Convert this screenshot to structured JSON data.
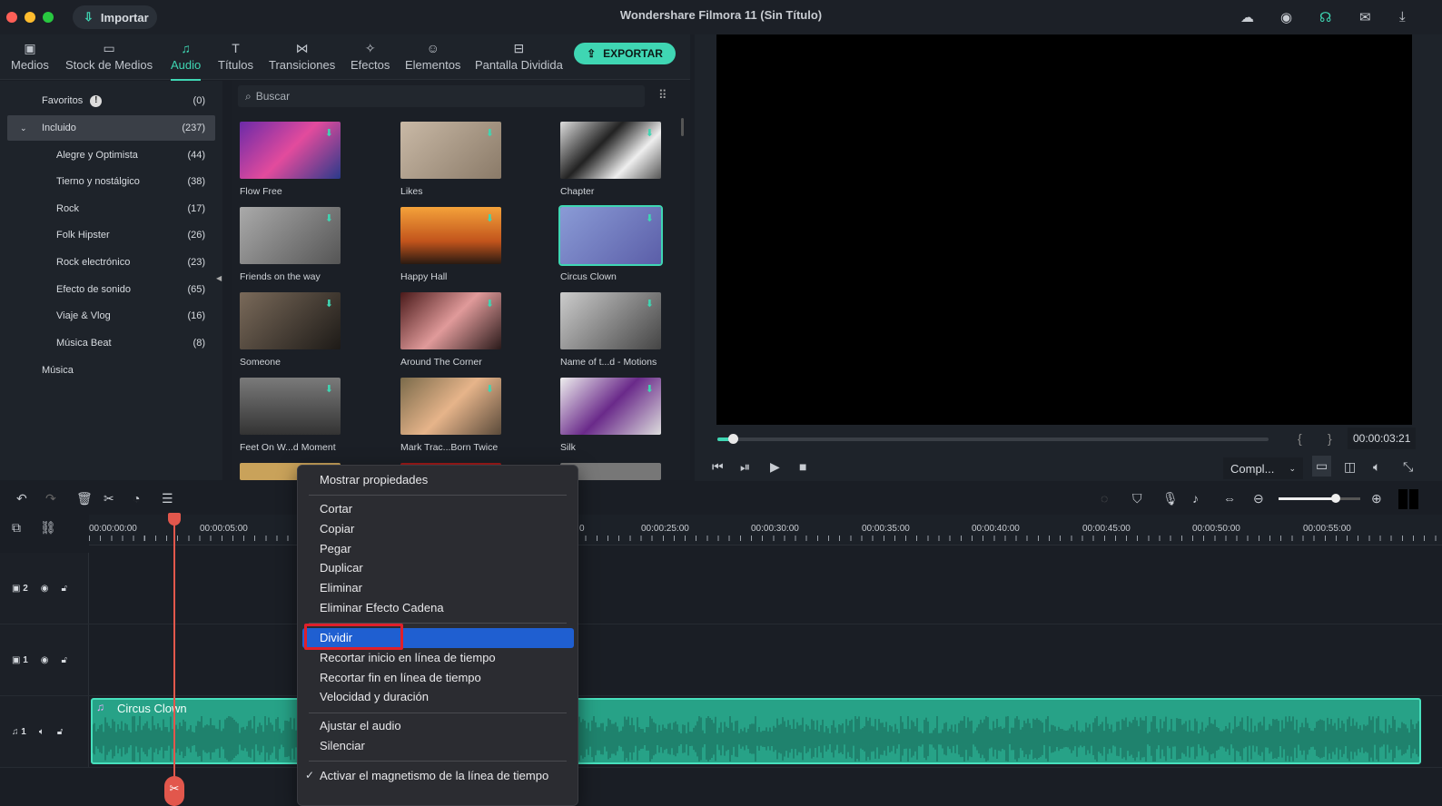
{
  "app": {
    "title": "Wondershare Filmora 11 (Sin Título)",
    "import_label": "Importar",
    "export_label": "EXPORTAR"
  },
  "nav": {
    "tabs": [
      {
        "label": "Medios",
        "icon": "image-icon"
      },
      {
        "label": "Stock de Medios",
        "icon": "folder-icon"
      },
      {
        "label": "Audio",
        "icon": "music-icon",
        "active": true
      },
      {
        "label": "Títulos",
        "icon": "text-icon"
      },
      {
        "label": "Transiciones",
        "icon": "transition-icon"
      },
      {
        "label": "Efectos",
        "icon": "sparkle-icon"
      },
      {
        "label": "Elementos",
        "icon": "smiley-icon"
      },
      {
        "label": "Pantalla Dividida",
        "icon": "split-screen-icon"
      }
    ]
  },
  "sidebar": {
    "items": [
      {
        "label": "Favoritos",
        "count": "(0)"
      },
      {
        "label": "Incluido",
        "count": "(237)"
      },
      {
        "label": "Alegre y Optimista",
        "count": "(44)"
      },
      {
        "label": "Tierno y nostálgico",
        "count": "(38)"
      },
      {
        "label": "Rock",
        "count": "(17)"
      },
      {
        "label": "Folk Hipster",
        "count": "(26)"
      },
      {
        "label": "Rock electrónico",
        "count": "(23)"
      },
      {
        "label": "Efecto de sonido",
        "count": "(65)"
      },
      {
        "label": "Viaje & Vlog",
        "count": "(16)"
      },
      {
        "label": "Música Beat",
        "count": "(8)"
      },
      {
        "label": "Música",
        "count": ""
      }
    ]
  },
  "search": {
    "placeholder": "Buscar"
  },
  "library": {
    "items": [
      {
        "label": "Flow Free"
      },
      {
        "label": "Likes"
      },
      {
        "label": "Chapter"
      },
      {
        "label": "Friends on the way"
      },
      {
        "label": "Happy Hall"
      },
      {
        "label": "Circus Clown",
        "selected": true
      },
      {
        "label": "Someone"
      },
      {
        "label": "Around The Corner"
      },
      {
        "label": "Name of t...d - Motions"
      },
      {
        "label": "Feet On W...d Moment"
      },
      {
        "label": "Mark Trac...Born Twice"
      },
      {
        "label": "Silk"
      }
    ]
  },
  "preview": {
    "timecode": "00:00:03:21",
    "quality": "Compl...",
    "progress": 0.01
  },
  "timeline": {
    "ruler": [
      "00:00:00:00",
      "00:00:05:00",
      "0",
      "00:00:25:00",
      "00:00:30:00",
      "00:00:35:00",
      "00:00:40:00",
      "00:00:45:00",
      "00:00:50:00",
      "00:00:55:00"
    ],
    "tracks": [
      {
        "label": "2"
      },
      {
        "label": "1"
      },
      {
        "label": "1"
      }
    ],
    "clip_name": "Circus Clown",
    "zoom": 0.7
  },
  "context_menu": {
    "items": [
      "Mostrar propiedades",
      "Cortar",
      "Copiar",
      "Pegar",
      "Duplicar",
      "Eliminar",
      "Eliminar Efecto Cadena",
      "Dividir",
      "Recortar inicio en línea de tiempo",
      "Recortar fin en línea de tiempo",
      "Velocidad y duración",
      "Ajustar el audio",
      "Silenciar",
      "Activar el magnetismo de la línea de tiempo"
    ],
    "highlighted": "Dividir",
    "checked": "Activar el magnetismo de la línea de tiempo"
  },
  "colors": {
    "accent": "#3fd6b3",
    "highlight": "#1f5fd1",
    "playhead": "#e2574c"
  }
}
